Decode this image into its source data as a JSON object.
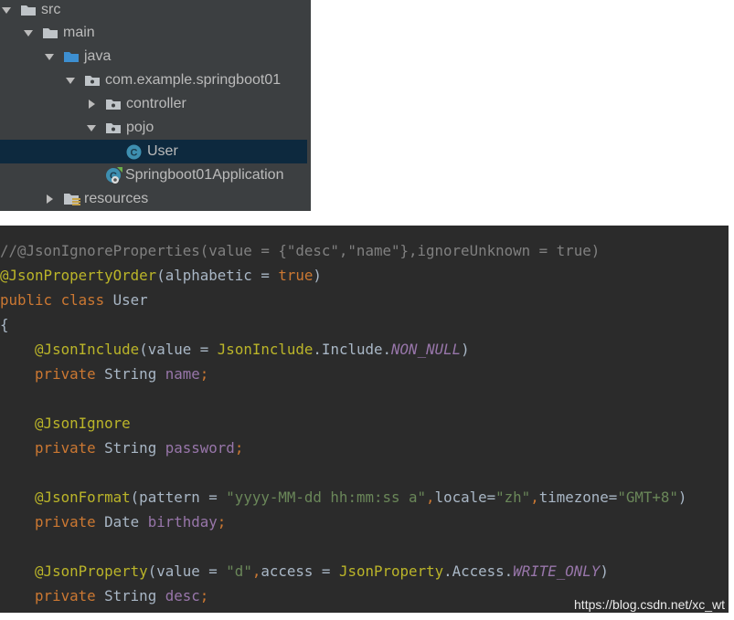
{
  "tree": {
    "items": [
      {
        "label": "src",
        "icon": "folder-icon",
        "expanded": true
      },
      {
        "label": "main",
        "icon": "folder-icon",
        "expanded": true
      },
      {
        "label": "java",
        "icon": "source-folder-icon",
        "expanded": true
      },
      {
        "label": "com.example.springboot01",
        "icon": "package-icon",
        "expanded": true
      },
      {
        "label": "controller",
        "icon": "package-icon",
        "expanded": false
      },
      {
        "label": "pojo",
        "icon": "package-icon",
        "expanded": true
      },
      {
        "label": "User",
        "icon": "class-icon",
        "selected": true
      },
      {
        "label": "Springboot01Application",
        "icon": "spring-boot-class-icon"
      },
      {
        "label": "resources",
        "icon": "resources-folder-icon",
        "expanded": false
      }
    ]
  },
  "code": {
    "lines": [
      [
        {
          "t": "//@JsonIgnoreProperties(value = {\"desc\",\"name\"},ignoreUnknown = true)",
          "c": "comment"
        }
      ],
      [
        {
          "t": "@JsonPropertyOrder",
          "c": "ann"
        },
        {
          "t": "(alphabetic = ",
          "c": "plain"
        },
        {
          "t": "true",
          "c": "kw"
        },
        {
          "t": ")",
          "c": "plain"
        }
      ],
      [
        {
          "t": "public class ",
          "c": "kw"
        },
        {
          "t": "User",
          "c": "plain"
        }
      ],
      [
        {
          "t": "{",
          "c": "plain"
        }
      ],
      [
        {
          "t": "    ",
          "c": "plain"
        },
        {
          "t": "@JsonInclude",
          "c": "ann"
        },
        {
          "t": "(value = ",
          "c": "plain"
        },
        {
          "t": "JsonInclude",
          "c": "ann"
        },
        {
          "t": ".Include.",
          "c": "plain"
        },
        {
          "t": "NON_NULL",
          "c": "const"
        },
        {
          "t": ")",
          "c": "plain"
        }
      ],
      [
        {
          "t": "    ",
          "c": "plain"
        },
        {
          "t": "private ",
          "c": "kw"
        },
        {
          "t": "String ",
          "c": "plain"
        },
        {
          "t": "name",
          "c": "field"
        },
        {
          "t": ";",
          "c": "kw"
        }
      ],
      [],
      [
        {
          "t": "    ",
          "c": "plain"
        },
        {
          "t": "@JsonIgnore",
          "c": "ann"
        }
      ],
      [
        {
          "t": "    ",
          "c": "plain"
        },
        {
          "t": "private ",
          "c": "kw"
        },
        {
          "t": "String ",
          "c": "plain"
        },
        {
          "t": "password",
          "c": "field"
        },
        {
          "t": ";",
          "c": "kw"
        }
      ],
      [],
      [
        {
          "t": "    ",
          "c": "plain"
        },
        {
          "t": "@JsonFormat",
          "c": "ann"
        },
        {
          "t": "(pattern = ",
          "c": "plain"
        },
        {
          "t": "\"yyyy-MM-dd hh:mm:ss a\"",
          "c": "str"
        },
        {
          "t": ",",
          "c": "kw"
        },
        {
          "t": "locale=",
          "c": "plain"
        },
        {
          "t": "\"zh\"",
          "c": "str"
        },
        {
          "t": ",",
          "c": "kw"
        },
        {
          "t": "timezone=",
          "c": "plain"
        },
        {
          "t": "\"GMT+8\"",
          "c": "str"
        },
        {
          "t": ")",
          "c": "plain"
        }
      ],
      [
        {
          "t": "    ",
          "c": "plain"
        },
        {
          "t": "private ",
          "c": "kw"
        },
        {
          "t": "Date ",
          "c": "plain"
        },
        {
          "t": "birthday",
          "c": "field"
        },
        {
          "t": ";",
          "c": "kw"
        }
      ],
      [],
      [
        {
          "t": "    ",
          "c": "plain"
        },
        {
          "t": "@JsonProperty",
          "c": "ann"
        },
        {
          "t": "(value = ",
          "c": "plain"
        },
        {
          "t": "\"d\"",
          "c": "str"
        },
        {
          "t": ",",
          "c": "kw"
        },
        {
          "t": "access = ",
          "c": "plain"
        },
        {
          "t": "JsonProperty",
          "c": "ann"
        },
        {
          "t": ".Access.",
          "c": "plain"
        },
        {
          "t": "WRITE_ONLY",
          "c": "const"
        },
        {
          "t": ")",
          "c": "plain"
        }
      ],
      [
        {
          "t": "    ",
          "c": "plain"
        },
        {
          "t": "private ",
          "c": "kw"
        },
        {
          "t": "String ",
          "c": "plain"
        },
        {
          "t": "desc",
          "c": "field"
        },
        {
          "t": ";",
          "c": "kw"
        }
      ]
    ]
  },
  "watermark": "https://blog.csdn.net/xc_wt",
  "colors": {
    "tree_bg": "#3c3f41",
    "selection_bg": "#0d293e",
    "code_bg": "#2b2b2b",
    "annotation": "#bbb529",
    "keyword": "#cc7832",
    "string": "#6a8759",
    "field": "#9876aa",
    "comment": "#808080"
  }
}
